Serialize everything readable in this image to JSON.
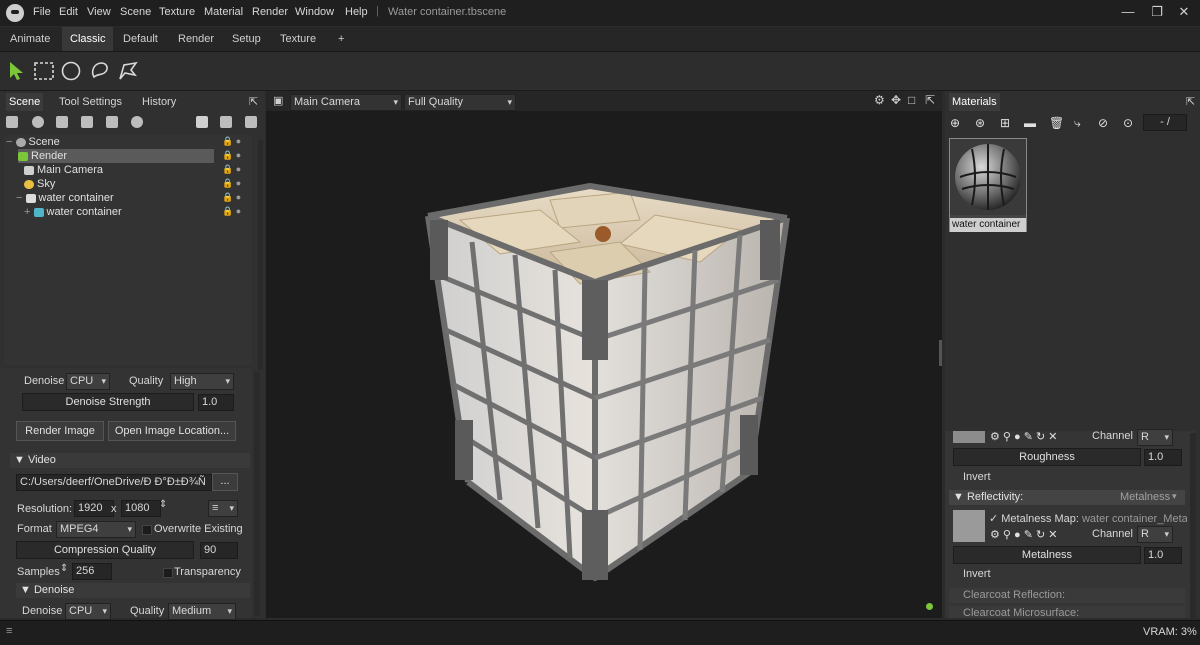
{
  "menu": [
    "File",
    "Edit",
    "View",
    "Scene",
    "Texture",
    "Material",
    "Render",
    "Window",
    "Help"
  ],
  "document_title": "Water container.tbscene",
  "window_controls": [
    "—",
    "❐",
    "✕"
  ],
  "workspace_tabs": [
    "Animate",
    "Classic",
    "Default",
    "Render",
    "Setup",
    "Texture",
    "+"
  ],
  "workspace_active": "Classic",
  "tools": [
    "select-arrow-icon",
    "rect-select-icon",
    "ellipse-select-icon",
    "lasso-select-icon",
    "paint-select-icon"
  ],
  "left_panel": {
    "tabs": [
      "Scene",
      "Tool Settings",
      "History"
    ],
    "tree": [
      {
        "label": "Scene",
        "icon": "scene-icon"
      },
      {
        "label": "Render",
        "icon": "render-icon"
      },
      {
        "label": "Main Camera",
        "icon": "camera-icon"
      },
      {
        "label": "Sky",
        "icon": "sky-icon"
      },
      {
        "label": "water container",
        "icon": "mesh-icon"
      },
      {
        "label": "water container",
        "icon": "submesh-icon"
      }
    ],
    "denoise_label": "Denoise",
    "denoise_value": "CPU",
    "quality_label": "Quality",
    "quality_value": "High",
    "denoise_strength_label": "Denoise Strength",
    "denoise_strength_value": "1.0",
    "render_image_btn": "Render Image",
    "open_location_btn": "Open Image Location...",
    "video_section": "Video",
    "video_path": "C:/Users/deerf/OneDrive/Ð Ð°Ð±Ð¾Ñ",
    "browse_btn": "...",
    "resolution_label": "Resolution:",
    "res_width": "1920",
    "res_x": "x",
    "res_height": "1080",
    "format_label": "Format",
    "format_value": "MPEG4",
    "overwrite_label": "Overwrite Existing",
    "compression_label": "Compression Quality",
    "compression_value": "90",
    "samples_label": "Samples",
    "samples_value": "256",
    "transparency_label": "Transparency",
    "denoise_section": "Denoise",
    "denoise2_value": "CPU",
    "quality2_value": "Medium"
  },
  "viewport": {
    "camera": "Main Camera",
    "quality": "Full Quality"
  },
  "right_panel": {
    "tab": "Materials",
    "material_name": "water container",
    "counter": "- /",
    "channel_label": "Channel",
    "channel_value": "R",
    "roughness_label": "Roughness",
    "roughness_value": "1.0",
    "invert_label": "Invert",
    "reflectivity_label": "Reflectivity:",
    "reflectivity_mode": "Metalness",
    "metalness_map_label": "✓ Metalness Map:",
    "metalness_map_value": "water container_Metallic",
    "metalness_label": "Metalness",
    "metalness_value": "1.0",
    "clearcoat_reflection": "Clearcoat Reflection:",
    "clearcoat_microsurface": "Clearcoat Microsurface:"
  },
  "status": {
    "vram": "VRAM: 3%"
  },
  "colors": {
    "accent_green": "#7cc63a",
    "selection": "#5a5a5a"
  }
}
